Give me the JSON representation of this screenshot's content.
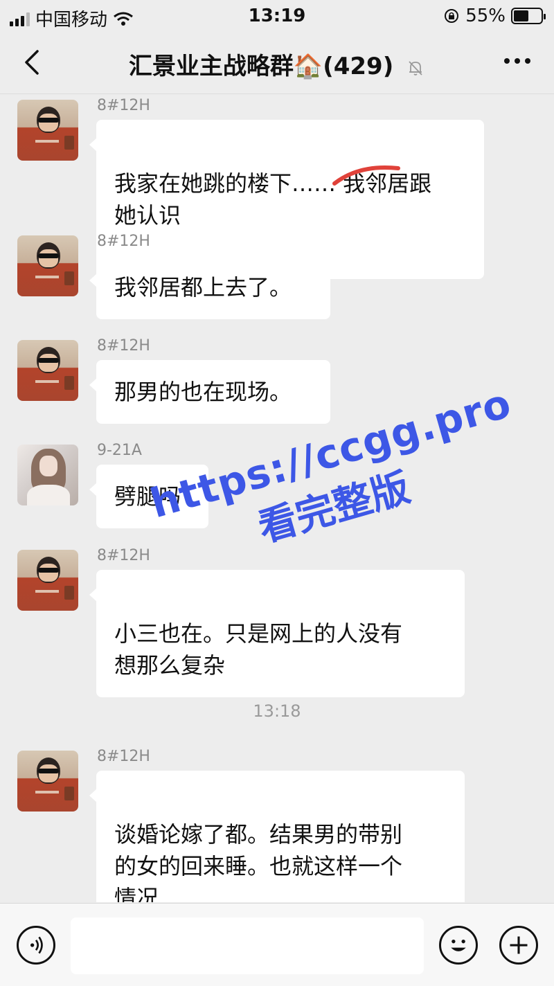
{
  "status_bar": {
    "carrier": "中国移动",
    "time": "13:19",
    "battery_percent": "55%",
    "battery_level": 0.55
  },
  "chat_header": {
    "title": "汇景业主战略群🏠(429)",
    "icons": [
      "back-arrow-icon",
      "mute-bell-icon",
      "more-icon"
    ]
  },
  "messages": [
    {
      "sender": "8#12H",
      "text": "我家在她跳的楼下…… 我邻居跟\n她认识"
    },
    {
      "sender": "8#12H",
      "text": "我邻居都上去了。"
    },
    {
      "sender": "8#12H",
      "text": "那男的也在现场。"
    },
    {
      "sender": "9-21A",
      "text": "劈腿吗"
    },
    {
      "sender": "8#12H",
      "text": "小三也在。只是网上的人没有\n想那么复杂"
    },
    {
      "sender": "8#12H",
      "text": "谈婚论嫁了都。结果男的带别\n的女的回来睡。也就这样一个\n情况"
    }
  ],
  "time_separator": "13:18",
  "watermark": {
    "url": "https://ccgg.pro",
    "text": "看完整版"
  },
  "input_bar": {
    "value": "",
    "icons": [
      "voice-icon",
      "emoji-icon",
      "plus-icon"
    ]
  },
  "colors": {
    "background": "#ededed",
    "bubble": "#ffffff",
    "watermark": "#3d57e6"
  }
}
